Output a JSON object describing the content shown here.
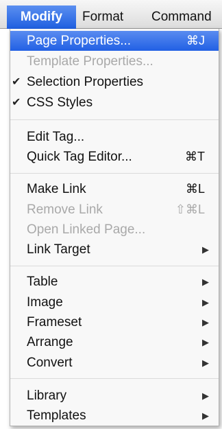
{
  "menubar": {
    "items": [
      {
        "label": "Modify",
        "active": true
      },
      {
        "label": "Format",
        "active": false
      },
      {
        "label": "Command",
        "active": false
      }
    ]
  },
  "menu": {
    "items": [
      {
        "label": "Page Properties...",
        "shortcut": "⌘J",
        "highlighted": true
      },
      {
        "label": "Template Properties...",
        "disabled": true
      },
      {
        "label": "Selection Properties",
        "checked": true
      },
      {
        "label": "CSS Styles",
        "checked": true
      },
      {
        "label": "Edit Tag..."
      },
      {
        "label": "Quick Tag Editor...",
        "shortcut": "⌘T"
      },
      {
        "label": "Make Link",
        "shortcut": "⌘L"
      },
      {
        "label": "Remove Link",
        "shortcut": "⇧⌘L",
        "disabled": true
      },
      {
        "label": "Open Linked Page...",
        "disabled": true
      },
      {
        "label": "Link Target",
        "submenu": true
      },
      {
        "label": "Table",
        "submenu": true
      },
      {
        "label": "Image",
        "submenu": true
      },
      {
        "label": "Frameset",
        "submenu": true
      },
      {
        "label": "Arrange",
        "submenu": true
      },
      {
        "label": "Convert",
        "submenu": true
      },
      {
        "label": "Library",
        "submenu": true
      },
      {
        "label": "Templates",
        "submenu": true
      }
    ],
    "check_glyph": "✔",
    "submenu_glyph": "▶"
  }
}
